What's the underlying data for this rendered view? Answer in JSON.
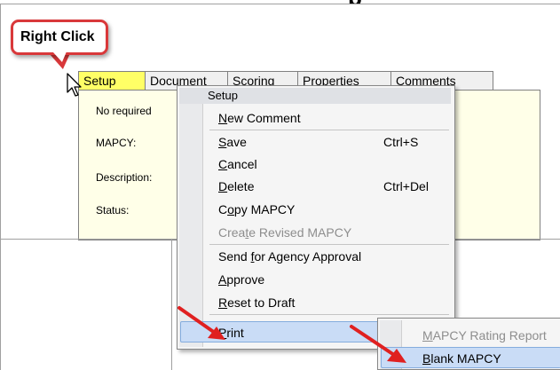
{
  "heading_fragment": "p",
  "callout": {
    "text": "Right Click"
  },
  "tabs": [
    {
      "label": "Setup",
      "active": true
    },
    {
      "label": "Document"
    },
    {
      "label": "Scoring"
    },
    {
      "label": "Properties"
    },
    {
      "label": "Comments"
    }
  ],
  "form": {
    "notice": "No required",
    "mapcy_label": "MAPCY:",
    "description_label": "Description:",
    "status_label": "Status:"
  },
  "context_menu": {
    "header": "Setup",
    "items": [
      {
        "label": "New Comment",
        "mnemonic": "N"
      },
      {
        "label": "Save",
        "mnemonic": "S",
        "shortcut": "Ctrl+S"
      },
      {
        "label": "Cancel",
        "mnemonic": "C"
      },
      {
        "label": "Delete",
        "mnemonic": "D",
        "shortcut": "Ctrl+Del"
      },
      {
        "label": "Copy MAPCY",
        "mnemonic": "o"
      },
      {
        "label": "Create Revised MAPCY",
        "mnemonic": "t",
        "disabled": true
      },
      {
        "label": "Send for Agency Approval",
        "mnemonic": "f"
      },
      {
        "label": "Approve",
        "mnemonic": "A"
      },
      {
        "label": "Reset to Draft",
        "mnemonic": "R"
      },
      {
        "label": "Print",
        "mnemonic": "P",
        "submenu": true,
        "highlighted": true
      }
    ]
  },
  "print_submenu": {
    "items": [
      {
        "label": "MAPCY Rating Report",
        "mnemonic": "M",
        "disabled": true
      },
      {
        "label": "Blank MAPCY",
        "mnemonic": "B",
        "highlighted": true
      }
    ]
  },
  "colors": {
    "callout_border": "#d9383a",
    "annotation_arrow": "#e02020",
    "active_tab": "#ffff66",
    "menu_highlight": "#c9dcf6"
  },
  "icons": {
    "cursor": "arrow-cursor-icon",
    "submenu": "chevron-right-icon",
    "annotation": "red-arrow-icon"
  }
}
